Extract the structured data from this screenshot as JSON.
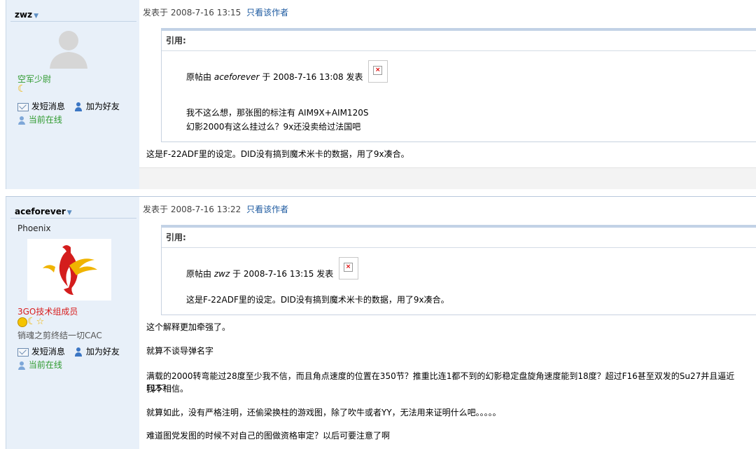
{
  "post1": {
    "username": "zwz",
    "rank": "空军少尉",
    "send_message": "发短消息",
    "add_friend": "加为好友",
    "online_status": "当前在线",
    "posted_at": "发表于  2008-7-16 13:15",
    "only_author": "只看该作者",
    "quote_title": "引用:",
    "quote_prefix": "原帖由",
    "quote_author": "aceforever",
    "quote_mid": "于  2008-7-16 13:08 发表",
    "quote_line1": "我不这么想，那张图的标注有  AIM9X+AIM120S",
    "quote_line2": "幻影2000有这么挂过么？9x还没卖给过法国吧",
    "body_line1": "这是F-22ADF里的设定。DID没有搞到魔术米卡的数据，用了9x凑合。"
  },
  "post2": {
    "username": "aceforever",
    "custom_title": "Phoenix",
    "rank": "3GO技术组成员",
    "signature": "销魂之剪终结一切CAC",
    "send_message": "发短消息",
    "add_friend": "加为好友",
    "online_status": "当前在线",
    "posted_at": "发表于  2008-7-16 13:22",
    "only_author": "只看该作者",
    "quote_title": "引用:",
    "quote_prefix": "原帖由",
    "quote_author": "zwz",
    "quote_mid": "于  2008-7-16 13:15 发表",
    "quote_line1": "这是F-22ADF里的设定。DID没有搞到魔术米卡的数据，用了9x凑合。",
    "body_line1": "这个解释更加牵强了。",
    "body_line2": "就算不谈导弹名字",
    "body_line3": "满载的2000转弯能过28度至少我不信，而且角点速度的位置在350节？推重比连1都不到的幻影稳定盘旋角速度能到18度？超过F16甚至双发的Su27并且逼近F15？",
    "body_line3b": "我不相信。",
    "body_line4": "就算如此，没有严格注明，还偷梁换柱的游戏图，除了吹牛或者YY，无法用来证明什么吧。。。。。",
    "body_line5": "难道图党发图的时候不对自己的图做资格审定？以后可要注意了啊"
  },
  "colors": {
    "rank_green": "#2e9a2e",
    "rank_red": "#d81e1e",
    "link_blue": "#1d5aa0"
  }
}
